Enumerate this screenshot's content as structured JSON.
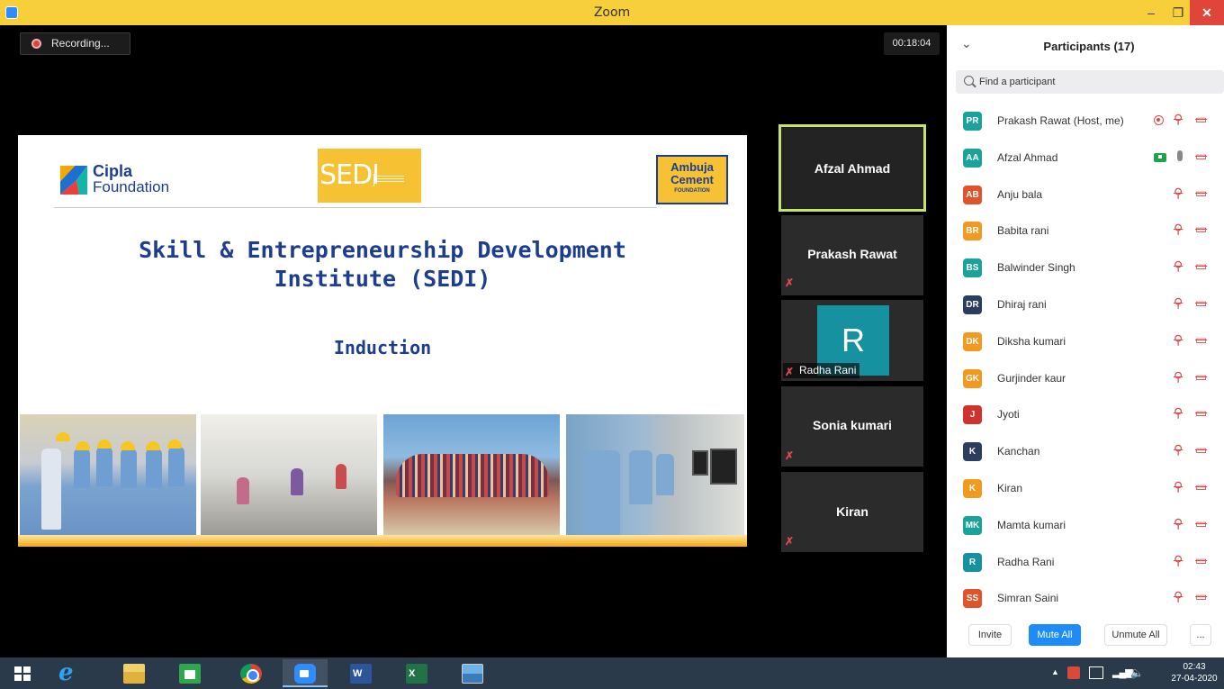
{
  "window": {
    "title": "Zoom",
    "min_glyph": "–",
    "max_glyph": "❐",
    "close_glyph": "✕"
  },
  "meeting": {
    "recording_label": "Recording...",
    "timer": "00:18:04"
  },
  "slide": {
    "cipla_word1": "Cipla",
    "cipla_word2": "Foundation",
    "sedi_logo_text": "SEDI",
    "ambuja_l1": "Ambuja",
    "ambuja_l2": "Cement",
    "ambuja_l3": "FOUNDATION",
    "heading_line1": "Skill & Entrepreneurship Development",
    "heading_line2": "Institute (SEDI)",
    "subheading": "Induction"
  },
  "video_tiles": [
    {
      "name": "Afzal Ahmad",
      "active_speaker": true
    },
    {
      "name": "Prakash Rawat",
      "muted": true
    },
    {
      "initial": "R",
      "name": "Radha Rani",
      "muted": true
    },
    {
      "name": "Sonia kumari",
      "muted": true
    },
    {
      "name": "Kiran",
      "muted": true
    }
  ],
  "participants": {
    "title": "Participants (17)",
    "search_placeholder": "Find a participant",
    "list": [
      {
        "initials": "PR",
        "name": "Prakash Rawat (Host, me)",
        "color": "#1aa39a"
      },
      {
        "initials": "AA",
        "name": "Afzal Ahmad",
        "color": "#1aa39a"
      },
      {
        "initials": "AB",
        "name": "Anju  bala",
        "color": "#e0542c"
      },
      {
        "initials": "BR",
        "name": "Babita rani",
        "color": "#f29a1f"
      },
      {
        "initials": "BS",
        "name": "Balwinder Singh",
        "color": "#1aa39a"
      },
      {
        "initials": "DR",
        "name": "Dhiraj rani",
        "color": "#2c3e60"
      },
      {
        "initials": "DK",
        "name": "Diksha kumari",
        "color": "#f29a1f"
      },
      {
        "initials": "GK",
        "name": "Gurjinder kaur",
        "color": "#f29a1f"
      },
      {
        "initials": "J",
        "name": "Jyoti",
        "color": "#d2322d"
      },
      {
        "initials": "K",
        "name": "Kanchan",
        "color": "#2c3e60"
      },
      {
        "initials": "K",
        "name": "Kiran",
        "color": "#f29a1f"
      },
      {
        "initials": "MK",
        "name": "Mamta kumari",
        "color": "#1aa39a"
      },
      {
        "initials": "R",
        "name": "Radha Rani",
        "color": "#1591a0"
      },
      {
        "initials": "SS",
        "name": "Simran Saini",
        "color": "#e0542c"
      }
    ],
    "invite_label": "Invite",
    "mute_all_label": "Mute All",
    "unmute_all_label": "Unmute All",
    "more_label": "..."
  },
  "taskbar": {
    "clock_time": "02:43",
    "clock_date": "27-04-2020",
    "word_letter": "W",
    "excel_letter": "X",
    "ie_letter": "e"
  },
  "icons": {
    "muted_mic": "🎤̸",
    "camera_off": "📷̸"
  }
}
